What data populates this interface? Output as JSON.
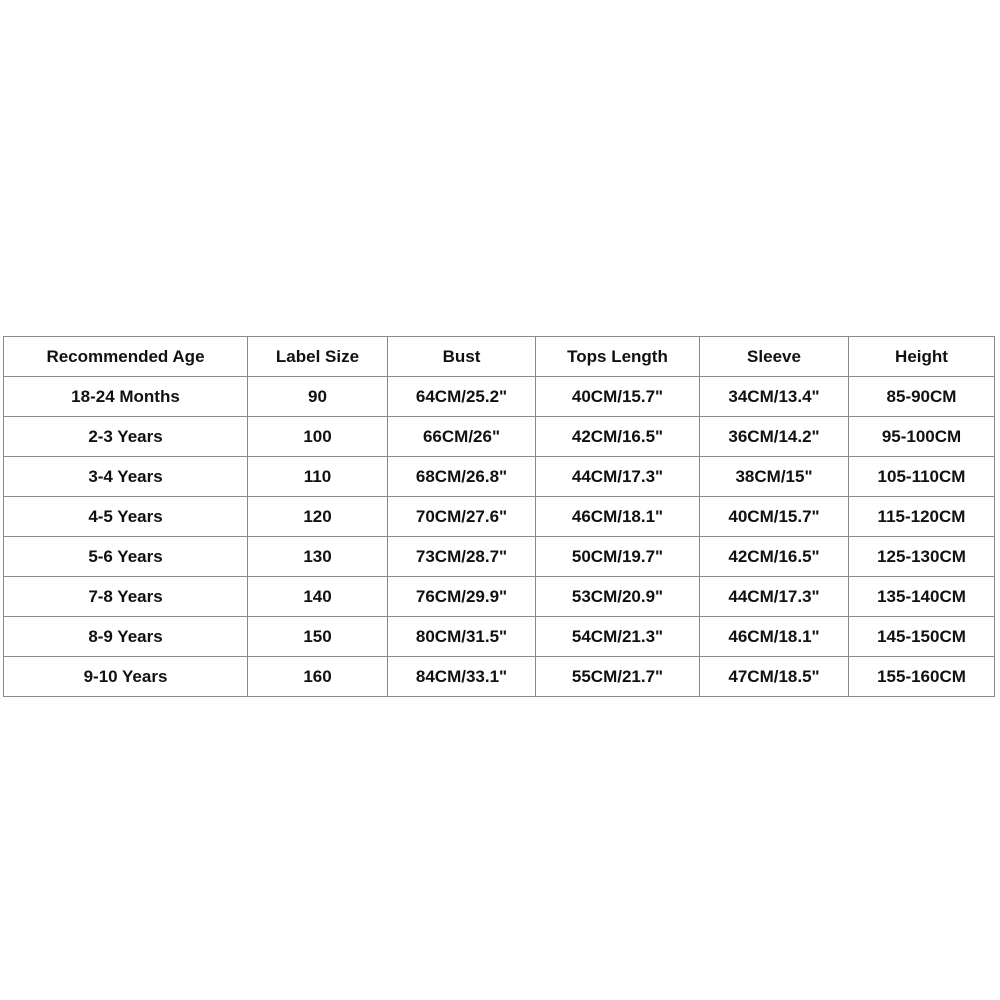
{
  "table": {
    "headers": [
      "Recommended Age",
      "Label Size",
      "Bust",
      "Tops Length",
      "Sleeve",
      "Height"
    ],
    "rows": [
      [
        "18-24 Months",
        "90",
        "64CM/25.2\"",
        "40CM/15.7\"",
        "34CM/13.4\"",
        "85-90CM"
      ],
      [
        "2-3 Years",
        "100",
        "66CM/26\"",
        "42CM/16.5\"",
        "36CM/14.2\"",
        "95-100CM"
      ],
      [
        "3-4 Years",
        "110",
        "68CM/26.8\"",
        "44CM/17.3\"",
        "38CM/15\"",
        "105-110CM"
      ],
      [
        "4-5 Years",
        "120",
        "70CM/27.6\"",
        "46CM/18.1\"",
        "40CM/15.7\"",
        "115-120CM"
      ],
      [
        "5-6 Years",
        "130",
        "73CM/28.7\"",
        "50CM/19.7\"",
        "42CM/16.5\"",
        "125-130CM"
      ],
      [
        "7-8 Years",
        "140",
        "76CM/29.9\"",
        "53CM/20.9\"",
        "44CM/17.3\"",
        "135-140CM"
      ],
      [
        "8-9 Years",
        "150",
        "80CM/31.5\"",
        "54CM/21.3\"",
        "46CM/18.1\"",
        "145-150CM"
      ],
      [
        "9-10 Years",
        "160",
        "84CM/33.1\"",
        "55CM/21.7\"",
        "47CM/18.5\"",
        "155-160CM"
      ]
    ]
  }
}
